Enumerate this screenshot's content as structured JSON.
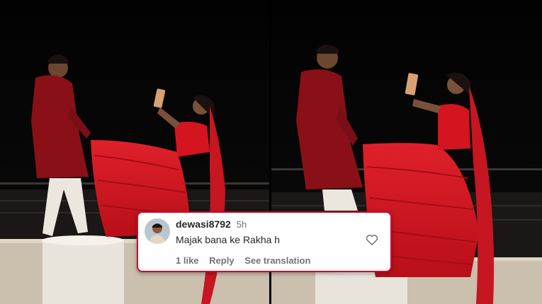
{
  "comment": {
    "username": "dewasi8792",
    "time": "5h",
    "text": "Majak bana ke Rakha h",
    "likes_label": "1 like",
    "reply_label": "Reply",
    "translate_label": "See translation"
  },
  "icons": {
    "like": "heart-outline-icon",
    "avatar": "user-avatar"
  },
  "colors": {
    "background": "#050505",
    "dress": "#d4141f",
    "kurta": "#8a1018",
    "card_border": "#c8102e"
  }
}
